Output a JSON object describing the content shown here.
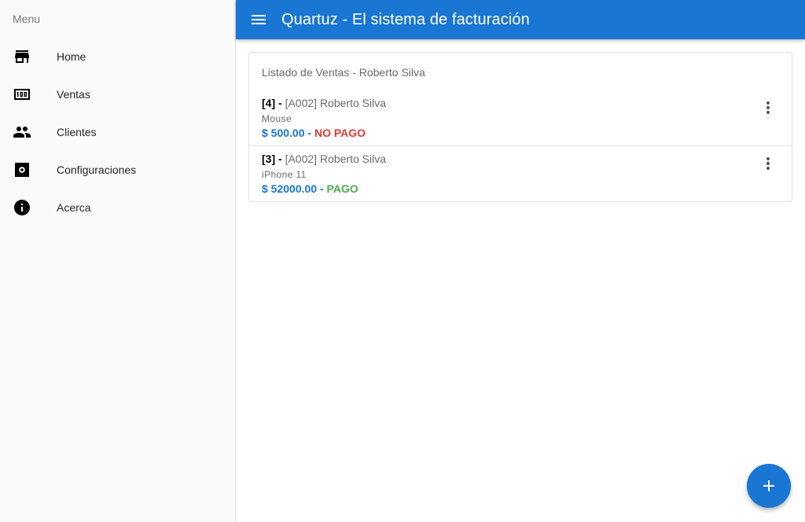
{
  "sidebar": {
    "title": "Menu",
    "items": [
      {
        "label": "Home",
        "icon": "store-icon"
      },
      {
        "label": "Ventas",
        "icon": "hundred-icon"
      },
      {
        "label": "Clientes",
        "icon": "people-icon"
      },
      {
        "label": "Configuraciones",
        "icon": "settings-icon"
      },
      {
        "label": "Acerca",
        "icon": "info-icon"
      }
    ]
  },
  "header": {
    "title": "Quartuz - El sistema de facturación",
    "menu_icon": "menu-icon"
  },
  "main": {
    "card_title": "Listado de Ventas - Roberto Silva",
    "sales": [
      {
        "id": "[4]",
        "dash": " - ",
        "client": "[A002] Roberto Silva",
        "product": "Mouse",
        "amount": "$ 500.00",
        "sep": " - ",
        "status": "NO PAGO",
        "status_color": "#e53935"
      },
      {
        "id": "[3]",
        "dash": " - ",
        "client": "[A002] Roberto Silva",
        "product": "iPhone 11",
        "amount": "$ 52000.00",
        "sep": " - ",
        "status": "PAGO",
        "status_color": "#4caf50"
      }
    ]
  },
  "fab": {
    "icon": "plus-icon"
  },
  "colors": {
    "primary": "#1976d2",
    "unpaid": "#e53935",
    "paid": "#4caf50"
  }
}
